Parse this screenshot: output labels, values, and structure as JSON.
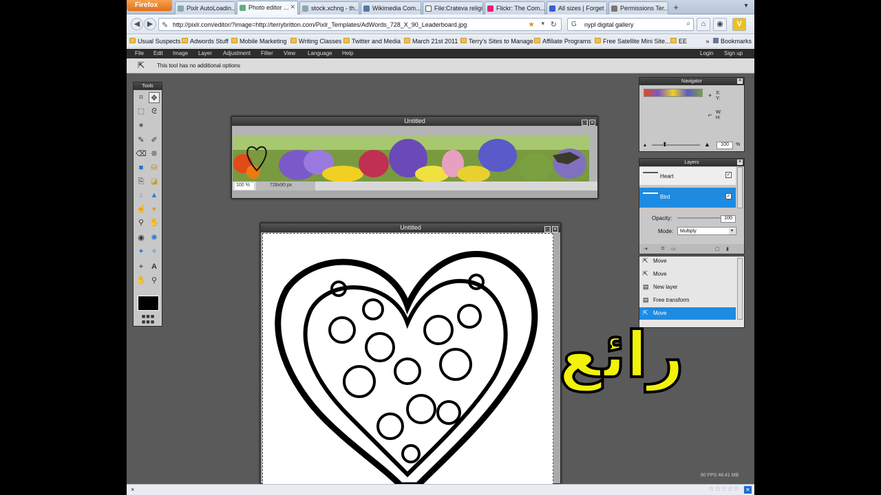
{
  "browser": {
    "firefox_button": "Firefox",
    "tabs": [
      {
        "label": "Pixlr AutoLoadin..."
      },
      {
        "label": "Photo editor ...",
        "active": true
      },
      {
        "label": "stock.xchng - th..."
      },
      {
        "label": "Wikimedia Com..."
      },
      {
        "label": "File:Crateva religi..."
      },
      {
        "label": "Flickr: The Com..."
      },
      {
        "label": "All sizes | Forget ..."
      },
      {
        "label": "Permissions Ter..."
      }
    ],
    "new_tab": "+",
    "url": "http://pixlr.com/editor/?image=http://terrybritton.com/Pixlr_Templates/AdWords_728_X_90_Leaderboard.jpg",
    "search_value": "nypl digital gallery",
    "bookmarks": [
      "Usual Suspects",
      "Adwords Stuff",
      "Mobile Marketing",
      "Writing Classes",
      "Twitter and Media",
      "March 21st 2011",
      "Terry's Sites to Manage",
      "Affiliate Programs",
      "Free Satellite Mini Site...",
      "EE"
    ],
    "bookmarks_overflow": "»",
    "bookmarks_label": "Bookmarks",
    "status_close": "×"
  },
  "pixlr": {
    "menu": [
      "File",
      "Edit",
      "Image",
      "Layer",
      "Adjustment",
      "Filter",
      "View",
      "Language",
      "Help"
    ],
    "login": "Login",
    "signup": "Sign up",
    "option_text": "This tool has no additional options",
    "tools_title": "Tools",
    "doc1": {
      "title": "Untitled",
      "zoom": "100 %",
      "size": "728x90 px"
    },
    "doc2": {
      "title": "Untitled"
    },
    "navigator": {
      "title": "Navigator",
      "x": "X:",
      "y": "Y:",
      "w": "W:",
      "h": "H:",
      "zoom": "100",
      "pct": "%"
    },
    "layers": {
      "title": "Layers",
      "items": [
        {
          "name": "Heart",
          "selected": false
        },
        {
          "name": "Bird",
          "selected": true
        }
      ],
      "opacity_label": "Opacity:",
      "opacity_value": "100",
      "opacity_level": 1.0,
      "mode_label": "Mode:",
      "mode_value": "Multiply"
    },
    "history": {
      "items": [
        {
          "label": "Move",
          "selected": false
        },
        {
          "label": "Move",
          "selected": false
        },
        {
          "label": "New layer",
          "selected": false
        },
        {
          "label": "Free transform",
          "selected": false
        },
        {
          "label": "Move",
          "selected": true
        }
      ]
    },
    "fps": "60 FPS 48.41 MB"
  },
  "overlay": {
    "text": "رائع",
    "color": "#f2f20a"
  },
  "colors": {
    "accent": "#1e8be0",
    "workspace": "#5a5a5a"
  }
}
